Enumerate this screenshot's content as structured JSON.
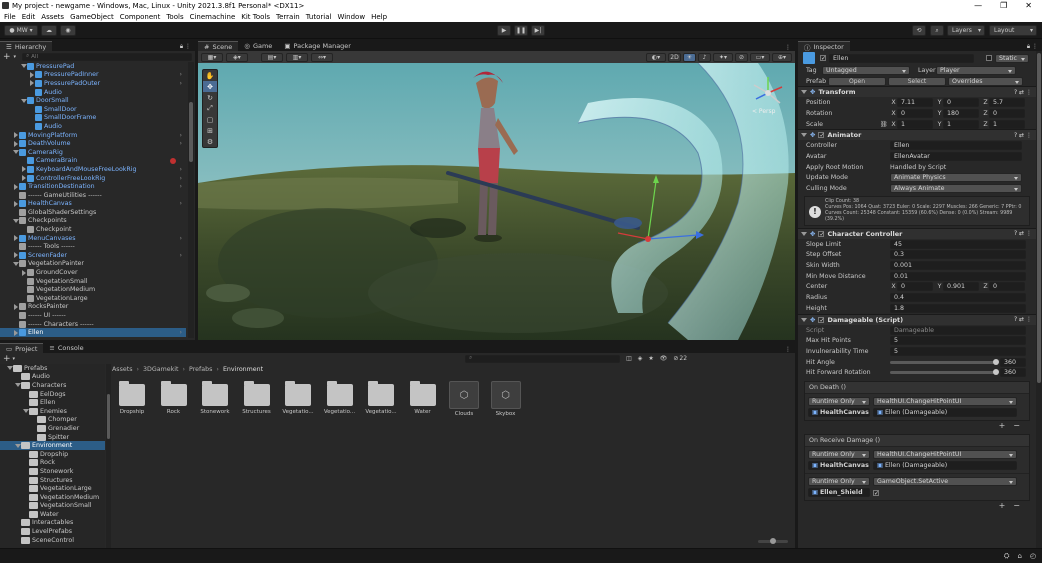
{
  "window": {
    "title": "My project - newgame - Windows, Mac, Linux - Unity 2021.3.8f1 Personal* <DX11>"
  },
  "menu": [
    "File",
    "Edit",
    "Assets",
    "GameObject",
    "Component",
    "Tools",
    "Cinemachine",
    "Kit Tools",
    "Terrain",
    "Tutorial",
    "Window",
    "Help"
  ],
  "toolbar": {
    "account": "MW",
    "layers": "Layers",
    "layout": "Layout"
  },
  "hierarchy": {
    "tab": "Hierarchy",
    "search_placeholder": "All",
    "items": [
      {
        "label": "PressurePad",
        "depth": 2,
        "expanded": true,
        "kind": "prefab"
      },
      {
        "label": "PressurePadInner",
        "depth": 3,
        "expanded": false,
        "kind": "prefab"
      },
      {
        "label": "PressurePadOuter",
        "depth": 3,
        "expanded": false,
        "kind": "prefab"
      },
      {
        "label": "Audio",
        "depth": 3,
        "expanded": null,
        "kind": "prefab"
      },
      {
        "label": "DoorSmall",
        "depth": 2,
        "expanded": true,
        "kind": "prefab"
      },
      {
        "label": "SmallDoor",
        "depth": 3,
        "expanded": null,
        "kind": "prefab"
      },
      {
        "label": "SmallDoorFrame",
        "depth": 3,
        "expanded": null,
        "kind": "prefab"
      },
      {
        "label": "Audio",
        "depth": 3,
        "expanded": null,
        "kind": "prefab"
      },
      {
        "label": "MovingPlatform",
        "depth": 1,
        "expanded": false,
        "kind": "prefab"
      },
      {
        "label": "DeathVolume",
        "depth": 1,
        "expanded": false,
        "kind": "prefab"
      },
      {
        "label": "CameraRig",
        "depth": 1,
        "expanded": true,
        "kind": "prefab"
      },
      {
        "label": "CameraBrain",
        "depth": 2,
        "expanded": null,
        "kind": "prefab"
      },
      {
        "label": "KeyboardAndMouseFreeLookRig",
        "depth": 2,
        "expanded": false,
        "kind": "prefab"
      },
      {
        "label": "ControllerFreeLookRig",
        "depth": 2,
        "expanded": false,
        "kind": "prefab"
      },
      {
        "label": "TransitionDestination",
        "depth": 1,
        "expanded": false,
        "kind": "prefab"
      },
      {
        "label": "------ GameUtilities ------",
        "depth": 1,
        "expanded": null,
        "kind": "plain"
      },
      {
        "label": "HealthCanvas",
        "depth": 1,
        "expanded": false,
        "kind": "prefab"
      },
      {
        "label": "GlobalShaderSettings",
        "depth": 1,
        "expanded": null,
        "kind": "plain"
      },
      {
        "label": "Checkpoints",
        "depth": 1,
        "expanded": true,
        "kind": "plain"
      },
      {
        "label": "Checkpoint",
        "depth": 2,
        "expanded": null,
        "kind": "plain"
      },
      {
        "label": "MenuCanvases",
        "depth": 1,
        "expanded": false,
        "kind": "prefab"
      },
      {
        "label": "------ Tools ------",
        "depth": 1,
        "expanded": null,
        "kind": "plain"
      },
      {
        "label": "ScreenFader",
        "depth": 1,
        "expanded": false,
        "kind": "prefab"
      },
      {
        "label": "VegetationPainter",
        "depth": 1,
        "expanded": true,
        "kind": "plain"
      },
      {
        "label": "GroundCover",
        "depth": 2,
        "expanded": false,
        "kind": "plain"
      },
      {
        "label": "VegetationSmall",
        "depth": 2,
        "expanded": null,
        "kind": "plain"
      },
      {
        "label": "VegetationMedium",
        "depth": 2,
        "expanded": null,
        "kind": "plain"
      },
      {
        "label": "VegetationLarge",
        "depth": 2,
        "expanded": null,
        "kind": "plain"
      },
      {
        "label": "RocksPainter",
        "depth": 1,
        "expanded": false,
        "kind": "plain"
      },
      {
        "label": "------ UI ------",
        "depth": 1,
        "expanded": null,
        "kind": "plain"
      },
      {
        "label": "------ Characters ------",
        "depth": 1,
        "expanded": null,
        "kind": "plain"
      },
      {
        "label": "Ellen",
        "depth": 1,
        "expanded": false,
        "kind": "prefab",
        "selected": true
      }
    ]
  },
  "scene": {
    "tabs": [
      "Scene",
      "Game",
      "Package Manager"
    ],
    "persp": "< Persp"
  },
  "project": {
    "tabs": [
      "Project",
      "Console"
    ],
    "breadcrumb": [
      "Assets",
      "3DGamekit",
      "Prefabs",
      "Environment"
    ],
    "count": "22",
    "tree": [
      {
        "label": "Prefabs",
        "depth": 0,
        "expanded": true
      },
      {
        "label": "Audio",
        "depth": 1,
        "expanded": null
      },
      {
        "label": "Characters",
        "depth": 1,
        "expanded": true
      },
      {
        "label": "EelDogs",
        "depth": 2,
        "expanded": null
      },
      {
        "label": "Ellen",
        "depth": 2,
        "expanded": null
      },
      {
        "label": "Enemies",
        "depth": 2,
        "expanded": true
      },
      {
        "label": "Chomper",
        "depth": 3,
        "expanded": null
      },
      {
        "label": "Grenadier",
        "depth": 3,
        "expanded": null
      },
      {
        "label": "Spitter",
        "depth": 3,
        "expanded": null
      },
      {
        "label": "Environment",
        "depth": 1,
        "expanded": true,
        "selected": true
      },
      {
        "label": "Dropship",
        "depth": 2,
        "expanded": null
      },
      {
        "label": "Rock",
        "depth": 2,
        "expanded": null
      },
      {
        "label": "Stonework",
        "depth": 2,
        "expanded": null
      },
      {
        "label": "Structures",
        "depth": 2,
        "expanded": null
      },
      {
        "label": "VegetationLarge",
        "depth": 2,
        "expanded": null
      },
      {
        "label": "VegetationMedium",
        "depth": 2,
        "expanded": null
      },
      {
        "label": "VegetationSmall",
        "depth": 2,
        "expanded": null
      },
      {
        "label": "Water",
        "depth": 2,
        "expanded": null
      },
      {
        "label": "Interactables",
        "depth": 1,
        "expanded": null
      },
      {
        "label": "LevelPrefabs",
        "depth": 1,
        "expanded": null
      },
      {
        "label": "SceneControl",
        "depth": 1,
        "expanded": null
      }
    ],
    "assets": [
      {
        "label": "Dropship",
        "kind": "folder"
      },
      {
        "label": "Rock",
        "kind": "folder"
      },
      {
        "label": "Stonework",
        "kind": "folder"
      },
      {
        "label": "Structures",
        "kind": "folder"
      },
      {
        "label": "Vegetatio...",
        "kind": "folder"
      },
      {
        "label": "Vegetatio...",
        "kind": "folder"
      },
      {
        "label": "Vegetatio...",
        "kind": "folder"
      },
      {
        "label": "Water",
        "kind": "folder"
      },
      {
        "label": "Clouds",
        "kind": "prefab"
      },
      {
        "label": "Skybox",
        "kind": "prefab"
      }
    ]
  },
  "inspector": {
    "tab": "Inspector",
    "object_name": "Ellen",
    "static_label": "Static",
    "tag_label": "Tag",
    "tag_value": "Untagged",
    "layer_label": "Layer",
    "layer_value": "Player",
    "prefab_label": "Prefab",
    "prefab_open": "Open",
    "prefab_select": "Select",
    "prefab_overrides": "Overrides",
    "transform": {
      "title": "Transform",
      "position_label": "Position",
      "position": [
        "7.11",
        "0",
        "5.7"
      ],
      "rotation_label": "Rotation",
      "rotation": [
        "0",
        "180",
        "0"
      ],
      "scale_label": "Scale",
      "scale": [
        "1",
        "1",
        "1"
      ]
    },
    "animator": {
      "title": "Animator",
      "controller_label": "Controller",
      "controller": "Ellen",
      "avatar_label": "Avatar",
      "avatar": "EllenAvatar",
      "root_label": "Apply Root Motion",
      "root": "Handled by Script",
      "update_label": "Update Mode",
      "update": "Animate Physics",
      "culling_label": "Culling Mode",
      "culling": "Always Animate",
      "info_lines": [
        "Clip Count: 38",
        "Curves Pos: 1064 Quat: 3723 Euler: 0 Scale: 2297 Muscles: 266 Generic: 7 PPtr: 0",
        "Curves Count: 25348 Constant: 15359 (60.6%) Dense: 0 (0.0%) Stream: 9989 (39.2%)"
      ]
    },
    "character_controller": {
      "title": "Character Controller",
      "slope_label": "Slope Limit",
      "slope": "45",
      "step_label": "Step Offset",
      "step": "0.3",
      "skin_label": "Skin Width",
      "skin": "0.001",
      "minmove_label": "Min Move Distance",
      "minmove": "0.01",
      "center_label": "Center",
      "center": [
        "0",
        "0.901",
        "0"
      ],
      "radius_label": "Radius",
      "radius": "0.4",
      "height_label": "Height",
      "height": "1.8"
    },
    "damageable": {
      "title": "Damageable (Script)",
      "script_label": "Script",
      "script": "Damageable",
      "maxhit_label": "Max Hit Points",
      "maxhit": "5",
      "invuln_label": "Invulnerability Time",
      "invuln": "5",
      "hitangle_label": "Hit Angle",
      "hitangle": "360",
      "hitangle_fraction": 1.0,
      "hitfwd_label": "Hit Forward Rotation",
      "hitfwd": "360",
      "hitfwd_fraction": 1.0,
      "ondeath_label": "On Death ()",
      "ondeath": {
        "mode": "Runtime Only",
        "func": "HealthUI.ChangeHitPointUI",
        "target": "HealthCanvas",
        "arg": "Ellen (Damageable)"
      },
      "onreceive_label": "On Receive Damage ()",
      "onreceive": [
        {
          "mode": "Runtime Only",
          "func": "HealthUI.ChangeHitPointUI",
          "target": "HealthCanvas",
          "arg": "Ellen (Damageable)"
        },
        {
          "mode": "Runtime Only",
          "func": "GameObject.SetActive",
          "target": "Ellen_Shield",
          "arg": ""
        }
      ]
    }
  }
}
